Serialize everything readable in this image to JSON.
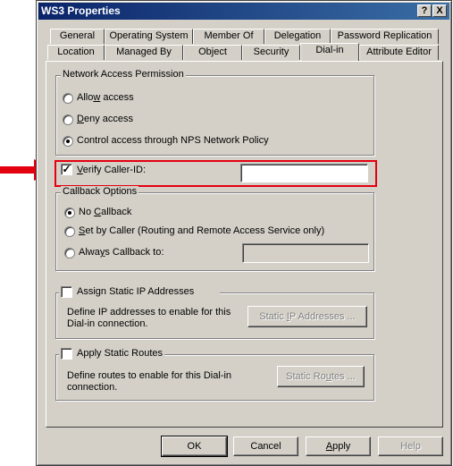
{
  "window": {
    "title": "WS3 Properties",
    "help_glyph": "?",
    "close_glyph": "X"
  },
  "tabs": {
    "row1": [
      "General",
      "Operating System",
      "Member Of",
      "Delegation",
      "Password Replication"
    ],
    "row2": [
      "Location",
      "Managed By",
      "Object",
      "Security",
      "Dial-in",
      "Attribute Editor"
    ],
    "active": "Dial-in"
  },
  "network_access": {
    "label": "Network Access Permission",
    "allow": {
      "pre": "Allo",
      "key": "w",
      "post": " access"
    },
    "deny": {
      "pre": "",
      "key": "D",
      "post": "eny access"
    },
    "control": "Control access through NPS Network Policy",
    "selected": "control"
  },
  "verify_caller": {
    "pre": "",
    "key": "V",
    "post": "erify Caller-ID:",
    "checked": true,
    "value": ""
  },
  "callback": {
    "label": "Callback Options",
    "none": {
      "pre": "No ",
      "key": "C",
      "post": "allback"
    },
    "set_by_caller": {
      "pre": "",
      "key": "S",
      "post": "et by Caller (Routing and Remote Access Service only)"
    },
    "always": {
      "pre": "Alwa",
      "key": "y",
      "post": "s Callback to:"
    },
    "always_value": "",
    "selected": "none"
  },
  "static_ip": {
    "label": "Assign Static IP Addresses",
    "checked": false,
    "description_line1": "Define IP addresses to enable for this",
    "description_line2": "Dial-in connection.",
    "button": {
      "pre": "Static ",
      "key": "I",
      "post": "P Addresses ..."
    }
  },
  "static_routes": {
    "label": "Apply Static Routes",
    "checked": false,
    "description_line1": "Define routes to enable for this Dial-in",
    "description_line2": "connection.",
    "button": {
      "pre": "Static Ro",
      "key": "u",
      "post": "tes ..."
    }
  },
  "footer": {
    "ok": "OK",
    "cancel": "Cancel",
    "apply": {
      "pre": "",
      "key": "A",
      "post": "pply"
    },
    "help": "Help"
  },
  "colors": {
    "highlight": "#e3000f",
    "arrow": "#e3000f",
    "titlebar": "#0a246a",
    "face": "#d4d0c8"
  }
}
